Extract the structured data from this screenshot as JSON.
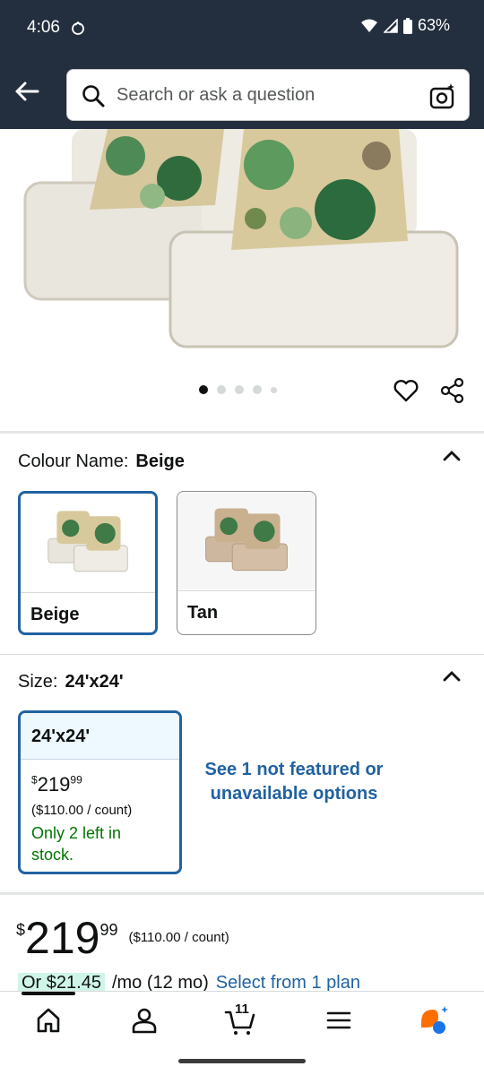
{
  "status_bar": {
    "time": "4:06",
    "battery": "63%"
  },
  "header": {
    "search_placeholder": "Search or ask a question"
  },
  "gallery": {
    "dot_count": 5,
    "active_index": 0
  },
  "colour": {
    "label": "Colour Name:",
    "selected": "Beige",
    "options": [
      {
        "name": "Beige",
        "selected": true
      },
      {
        "name": "Tan",
        "selected": false
      }
    ]
  },
  "size": {
    "label": "Size:",
    "selected": "24'x24'",
    "card": {
      "name": "24'x24'",
      "price_symbol": "$",
      "price_whole": "219",
      "price_fraction": "99",
      "unit_price": "($110.00 / count)",
      "stock": "Only 2 left in stock."
    },
    "see_more": "See 1 not featured or unavailable options"
  },
  "price": {
    "symbol": "$",
    "whole": "219",
    "fraction": "99",
    "unit_price": "($110.00 / count)"
  },
  "monthly": {
    "amount": "Or $21.45",
    "terms": "/mo (12 mo)",
    "link": "Select from 1 plan"
  },
  "bottom_nav": {
    "cart_count": "11"
  },
  "colors": {
    "header_bg": "#232f3e",
    "link": "#2162a1",
    "in_stock": "#007600",
    "selected_border": "#2162a1"
  }
}
